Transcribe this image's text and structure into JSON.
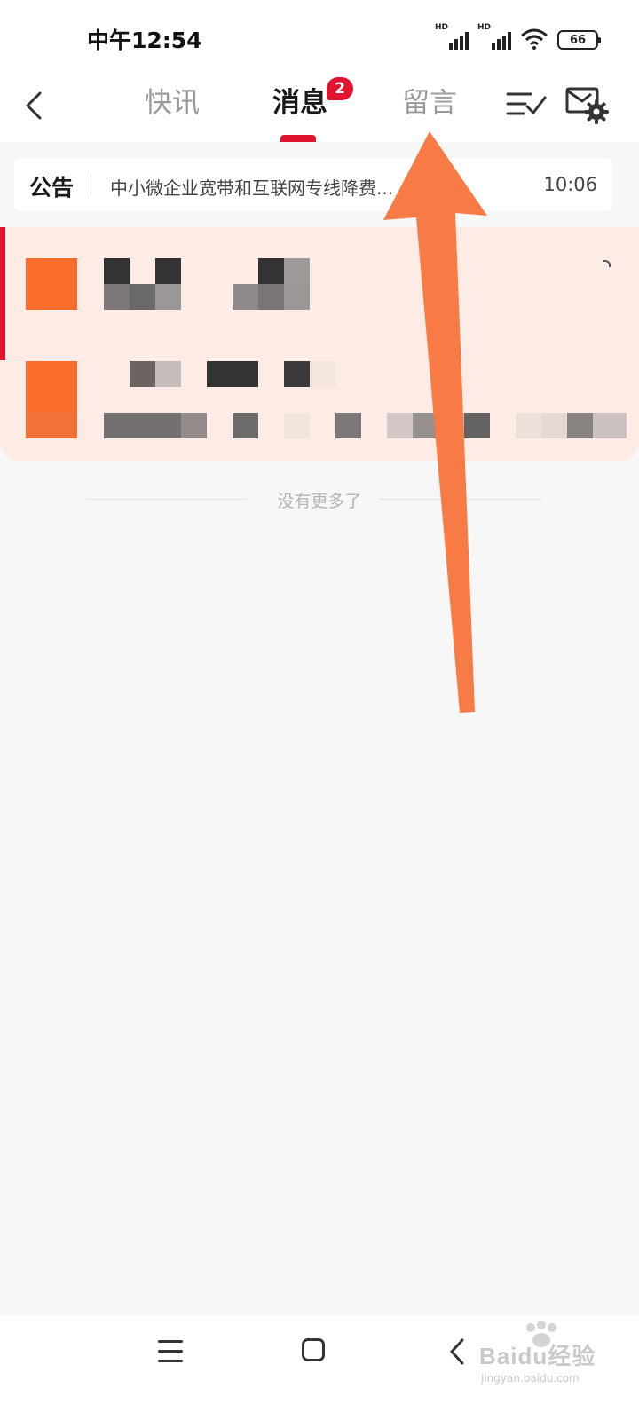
{
  "status_bar": {
    "time": "中午12:54",
    "network_1": "HD",
    "network_2": "HD",
    "battery": "66"
  },
  "header": {
    "tabs": [
      {
        "label": "快讯",
        "active": false
      },
      {
        "label": "消息",
        "active": true,
        "badge": "2"
      },
      {
        "label": "留言",
        "active": false
      }
    ],
    "accent_color": "#e0142f"
  },
  "notice": {
    "label": "公告",
    "text": "中小微企业宽带和互联网专线降费...",
    "time": "10:06"
  },
  "messages": {
    "list_end": "没有更多了",
    "card_background": "#fcece5",
    "avatar_color": "#fa6d2c"
  },
  "navigation": {
    "icons": [
      "menu-icon",
      "home-icon",
      "back-icon"
    ]
  },
  "watermark": {
    "main": "Baidu经验",
    "sub": "jingyan.baidu.com"
  },
  "annotation": {
    "color": "#f87b45",
    "points_to": "留言"
  }
}
